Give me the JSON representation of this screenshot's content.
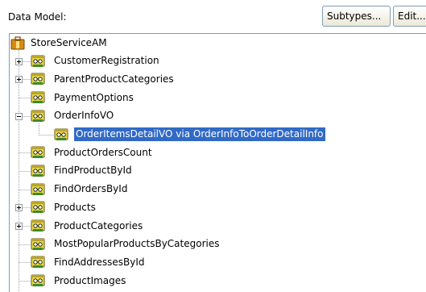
{
  "header": {
    "label": "Data Model:"
  },
  "buttons": {
    "subtypes": "Subtypes...",
    "edit": "Edit..."
  },
  "tree": {
    "root_label": "StoreServiceAM",
    "items": [
      {
        "label": "CustomerRegistration",
        "expander": "collapsed"
      },
      {
        "label": "ParentProductCategories",
        "expander": "collapsed"
      },
      {
        "label": "PaymentOptions",
        "expander": "none"
      },
      {
        "label": "OrderInfoVO",
        "expander": "expanded"
      },
      {
        "label": "OrderItemsDetailVO via OrderInfoToOrderDetailInfo",
        "expander": "none",
        "selected": true
      },
      {
        "label": "ProductOrdersCount",
        "expander": "none"
      },
      {
        "label": "FindProductById",
        "expander": "none"
      },
      {
        "label": "FindOrdersById",
        "expander": "none"
      },
      {
        "label": "Products",
        "expander": "collapsed"
      },
      {
        "label": "ProductCategories",
        "expander": "collapsed"
      },
      {
        "label": "MostPopularProductsByCategories",
        "expander": "none"
      },
      {
        "label": "FindAddressesById",
        "expander": "none"
      },
      {
        "label": "ProductImages",
        "expander": "none"
      }
    ]
  },
  "colors": {
    "selection": "#316ac5",
    "selection_text": "#ffffff",
    "border": "#7f9db9",
    "connector": "#a0a0a0",
    "view_icon_fill": "#e7d84a",
    "root_icon_fill": "#d88a12"
  },
  "icons": {
    "root": "application-module-icon",
    "view_object": "view-object-icon"
  }
}
